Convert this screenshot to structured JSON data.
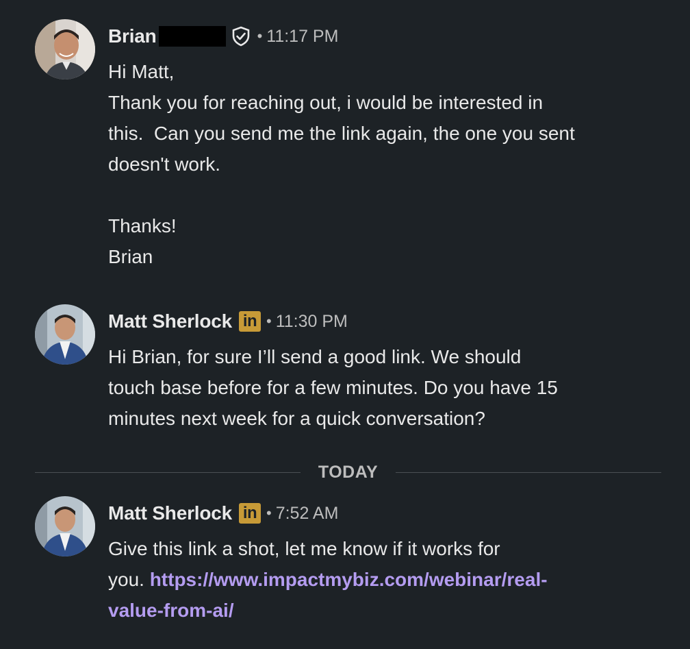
{
  "messages": [
    {
      "sender": "Brian",
      "badge": "verified-shield-icon",
      "timestamp": "11:17 PM",
      "body": "Hi Matt,\nThank you for reaching out, i would be interested in\nthis.  Can you send me the link again, the one you sent\ndoesn't work.\n\nThanks!\nBrian"
    },
    {
      "sender": "Matt Sherlock",
      "badge": "linkedin-premium-icon",
      "badge_text": "in",
      "timestamp": "11:30 PM",
      "body": "Hi Brian, for sure I’ll send a good link. We should\ntouch base before for a few minutes. Do you have 15\nminutes next week for a quick conversation?"
    },
    {
      "sender": "Matt Sherlock",
      "badge": "linkedin-premium-icon",
      "badge_text": "in",
      "timestamp": "7:52 AM",
      "body_prefix": "Give this link a shot, let me know if it works for\nyou. ",
      "link": "https://www.impactmybiz.com/webinar/real-\nvalue-from-ai/"
    }
  ],
  "divider": {
    "label": "TODAY"
  },
  "separator": "•",
  "colors": {
    "background": "#1d2226",
    "text": "#e9e9e9",
    "muted": "#bdbdbd",
    "link": "#b49cf0",
    "linkedin_badge": "#c79a37"
  }
}
